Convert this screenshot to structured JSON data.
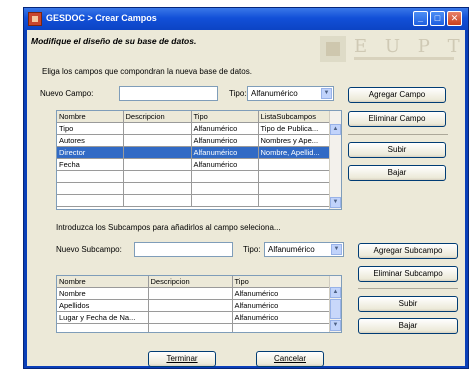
{
  "window": {
    "title": "GESDOC > Crear Campos",
    "header_title": "Modifique el diseño de su base de datos.",
    "logo_text": "E U P T"
  },
  "fields": {
    "instruction": "Eliga los campos que compondran la nueva base de datos.",
    "name_label": "Nuevo Campo:",
    "name_value": "",
    "type_label": "Tipo:",
    "type_value": "Alfanumérico",
    "buttons": {
      "add": "Agregar Campo",
      "remove": "Eliminar Campo",
      "up": "Subir",
      "down": "Bajar"
    },
    "table": {
      "columns": [
        "Nombre",
        "Descripcion",
        "Tipo",
        "ListaSubcampos"
      ],
      "rows": [
        [
          "Tipo",
          "",
          "Alfanumérico",
          "Tipo de Publica..."
        ],
        [
          "Autores",
          "",
          "Alfanumérico",
          "Nombres y Ape..."
        ],
        [
          "Director",
          "",
          "Alfanumérico",
          "Nombre, Apellid..."
        ],
        [
          "Fecha",
          "",
          "Alfanumérico",
          ""
        ],
        [
          "",
          "",
          "",
          ""
        ],
        [
          "",
          "",
          "",
          ""
        ],
        [
          "",
          "",
          "",
          ""
        ]
      ],
      "selected_row": 2
    }
  },
  "subfields": {
    "instruction": "Introduzca los Subcampos para añadirlos al campo seleciona...",
    "name_label": "Nuevo Subcampo:",
    "name_value": "",
    "type_label": "Tipo:",
    "type_value": "Alfanumérico",
    "buttons": {
      "add": "Agregar Subcampo",
      "remove": "Eliminar Subcampo",
      "up": "Subir",
      "down": "Bajar"
    },
    "table": {
      "columns": [
        "Nombre",
        "Descripcion",
        "Tipo"
      ],
      "rows": [
        [
          "Nombre",
          "",
          "Alfanumérico"
        ],
        [
          "Apellidos",
          "",
          "Alfanumérico"
        ],
        [
          "Lugar y Fecha de Na...",
          "",
          "Alfanumérico"
        ],
        [
          "",
          "",
          ""
        ]
      ]
    }
  },
  "footer": {
    "finish": "Terminar",
    "cancel": "Cancelar"
  }
}
